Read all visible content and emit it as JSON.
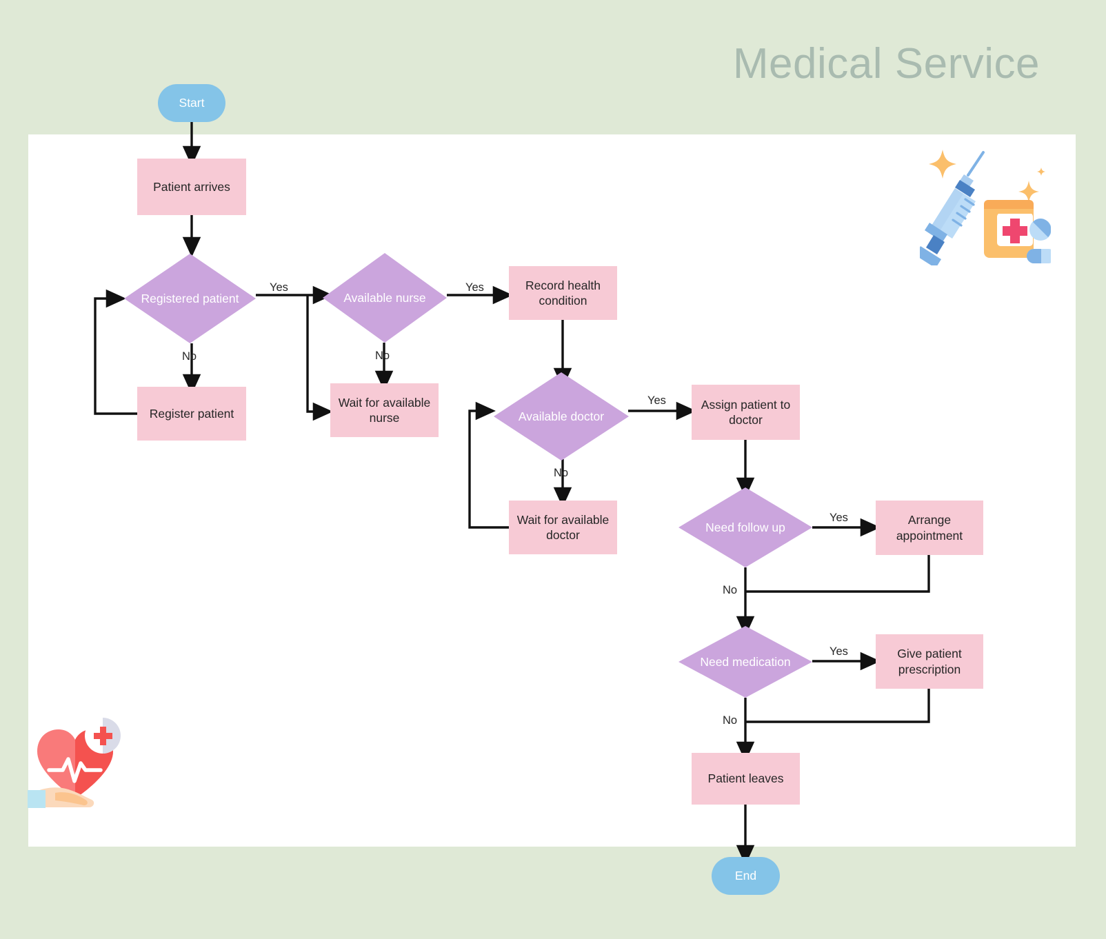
{
  "page": {
    "title": "Medical Service",
    "background_color": "#dfe9d6",
    "canvas_color": "#ffffff",
    "title_color": "#a9bbb0"
  },
  "palette": {
    "process": "#f7cad5",
    "decision": "#cba5dd",
    "terminal": "#84c4e8",
    "connector": "#111111",
    "process_text": "#262626",
    "decision_text": "#ffffff",
    "terminal_text": "#ffffff"
  },
  "nodes": {
    "start": "Start",
    "patient_arrives": "Patient arrives",
    "registered_patient": "Registered patient",
    "register_patient": "Register patient",
    "available_nurse": "Available nurse",
    "wait_nurse": "Wait for available nurse",
    "record_health": "Record health condition",
    "available_doctor": "Available doctor",
    "wait_doctor": "Wait for available doctor",
    "assign_doctor": "Assign patient to doctor",
    "need_follow_up": "Need follow up",
    "arrange_appointment": "Arrange appointment",
    "need_medication": "Need medication",
    "give_prescription": "Give patient prescription",
    "patient_leaves": "Patient leaves",
    "end": "End"
  },
  "edge_labels": {
    "registered_yes": "Yes",
    "registered_no": "No",
    "nurse_yes": "Yes",
    "nurse_no": "No",
    "doctor_yes": "Yes",
    "doctor_no": "No",
    "follow_up_yes": "Yes",
    "follow_up_no": "No",
    "medication_yes": "Yes",
    "medication_no": "No"
  },
  "chart_data": {
    "type": "diagram",
    "title": "Medical Service",
    "diagram_kind": "flowchart",
    "nodes": [
      {
        "id": "start",
        "label": "Start",
        "shape": "terminal",
        "color": "#84c4e8"
      },
      {
        "id": "patient_arrives",
        "label": "Patient arrives",
        "shape": "process",
        "color": "#f7cad5"
      },
      {
        "id": "registered_patient",
        "label": "Registered patient",
        "shape": "decision",
        "color": "#cba5dd"
      },
      {
        "id": "register_patient",
        "label": "Register patient",
        "shape": "process",
        "color": "#f7cad5"
      },
      {
        "id": "available_nurse",
        "label": "Available nurse",
        "shape": "decision",
        "color": "#cba5dd"
      },
      {
        "id": "wait_nurse",
        "label": "Wait for available nurse",
        "shape": "process",
        "color": "#f7cad5"
      },
      {
        "id": "record_health",
        "label": "Record health condition",
        "shape": "process",
        "color": "#f7cad5"
      },
      {
        "id": "available_doctor",
        "label": "Available doctor",
        "shape": "decision",
        "color": "#cba5dd"
      },
      {
        "id": "wait_doctor",
        "label": "Wait for available doctor",
        "shape": "process",
        "color": "#f7cad5"
      },
      {
        "id": "assign_doctor",
        "label": "Assign patient to doctor",
        "shape": "process",
        "color": "#f7cad5"
      },
      {
        "id": "need_follow_up",
        "label": "Need follow up",
        "shape": "decision",
        "color": "#cba5dd"
      },
      {
        "id": "arrange_appointment",
        "label": "Arrange appointment",
        "shape": "process",
        "color": "#f7cad5"
      },
      {
        "id": "need_medication",
        "label": "Need medication",
        "shape": "decision",
        "color": "#cba5dd"
      },
      {
        "id": "give_prescription",
        "label": "Give patient prescription",
        "shape": "process",
        "color": "#f7cad5"
      },
      {
        "id": "patient_leaves",
        "label": "Patient leaves",
        "shape": "process",
        "color": "#f7cad5"
      },
      {
        "id": "end",
        "label": "End",
        "shape": "terminal",
        "color": "#84c4e8"
      }
    ],
    "edges": [
      {
        "from": "start",
        "to": "patient_arrives",
        "label": ""
      },
      {
        "from": "patient_arrives",
        "to": "registered_patient",
        "label": ""
      },
      {
        "from": "registered_patient",
        "to": "available_nurse",
        "label": "Yes"
      },
      {
        "from": "registered_patient",
        "to": "register_patient",
        "label": "No"
      },
      {
        "from": "register_patient",
        "to": "registered_patient",
        "label": ""
      },
      {
        "from": "available_nurse",
        "to": "record_health",
        "label": "Yes"
      },
      {
        "from": "available_nurse",
        "to": "wait_nurse",
        "label": "No"
      },
      {
        "from": "wait_nurse",
        "to": "available_nurse",
        "label": ""
      },
      {
        "from": "record_health",
        "to": "available_doctor",
        "label": ""
      },
      {
        "from": "available_doctor",
        "to": "assign_doctor",
        "label": "Yes"
      },
      {
        "from": "available_doctor",
        "to": "wait_doctor",
        "label": "No"
      },
      {
        "from": "wait_doctor",
        "to": "available_doctor",
        "label": ""
      },
      {
        "from": "assign_doctor",
        "to": "need_follow_up",
        "label": ""
      },
      {
        "from": "need_follow_up",
        "to": "arrange_appointment",
        "label": "Yes"
      },
      {
        "from": "need_follow_up",
        "to": "need_medication",
        "label": "No"
      },
      {
        "from": "arrange_appointment",
        "to": "need_medication",
        "label": ""
      },
      {
        "from": "need_medication",
        "to": "give_prescription",
        "label": "Yes"
      },
      {
        "from": "need_medication",
        "to": "patient_leaves",
        "label": "No"
      },
      {
        "from": "give_prescription",
        "to": "patient_leaves",
        "label": ""
      },
      {
        "from": "patient_leaves",
        "to": "end",
        "label": ""
      }
    ]
  },
  "decorations": {
    "medicine_icon": "syringe-pills-bottle-illustration",
    "heart_icon": "hand-holding-heart-illustration"
  }
}
